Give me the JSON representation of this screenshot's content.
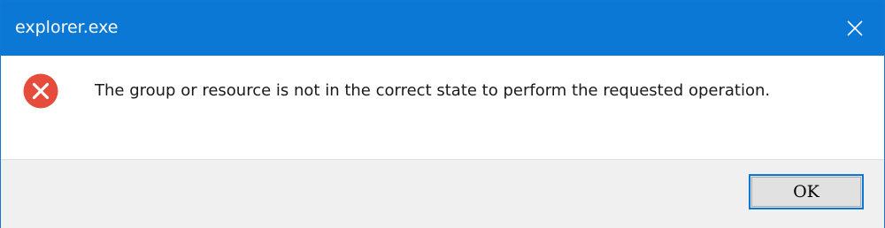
{
  "dialog": {
    "title": "explorer.exe",
    "message": "The group or resource is not in the correct state to perform the requested operation.",
    "ok_label": "OK",
    "icon": "error-icon",
    "close_icon": "close-icon"
  },
  "colors": {
    "titlebar": "#0a78d4",
    "error_red": "#e64c3c",
    "footer": "#f0f0f0",
    "button_border_focus": "#0a78d4"
  }
}
